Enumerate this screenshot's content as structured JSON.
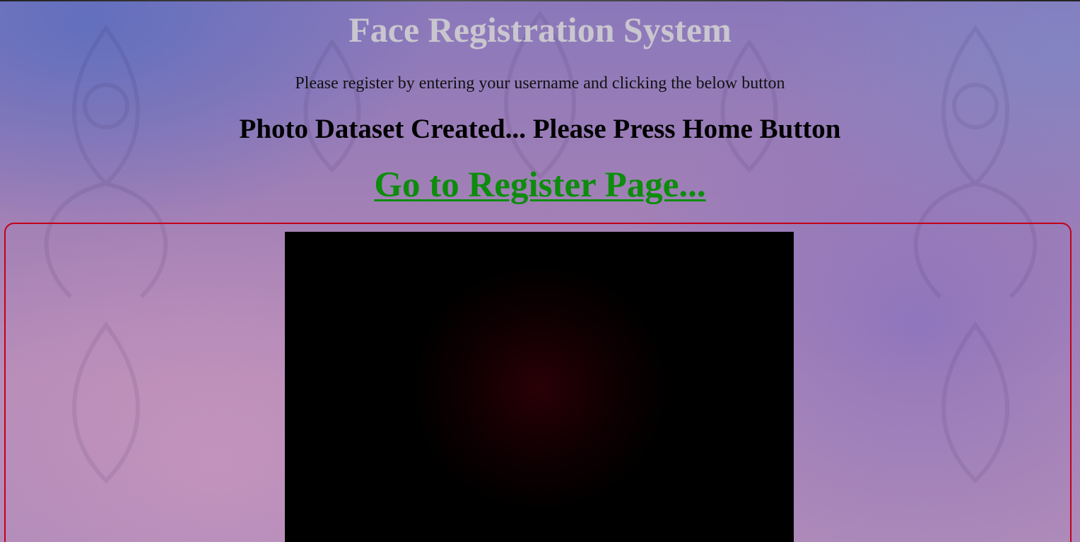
{
  "header": {
    "title": "Face Registration System",
    "instructions": "Please register by entering your username and clicking the below button"
  },
  "status": {
    "message": "Photo Dataset Created... Please Press Home Button"
  },
  "nav": {
    "register_link_label": "Go to Register Page..."
  },
  "colors": {
    "title": "#c9c6cf",
    "link": "#0d8c0d",
    "panel_border": "#c4001a",
    "video_background": "#000000"
  }
}
